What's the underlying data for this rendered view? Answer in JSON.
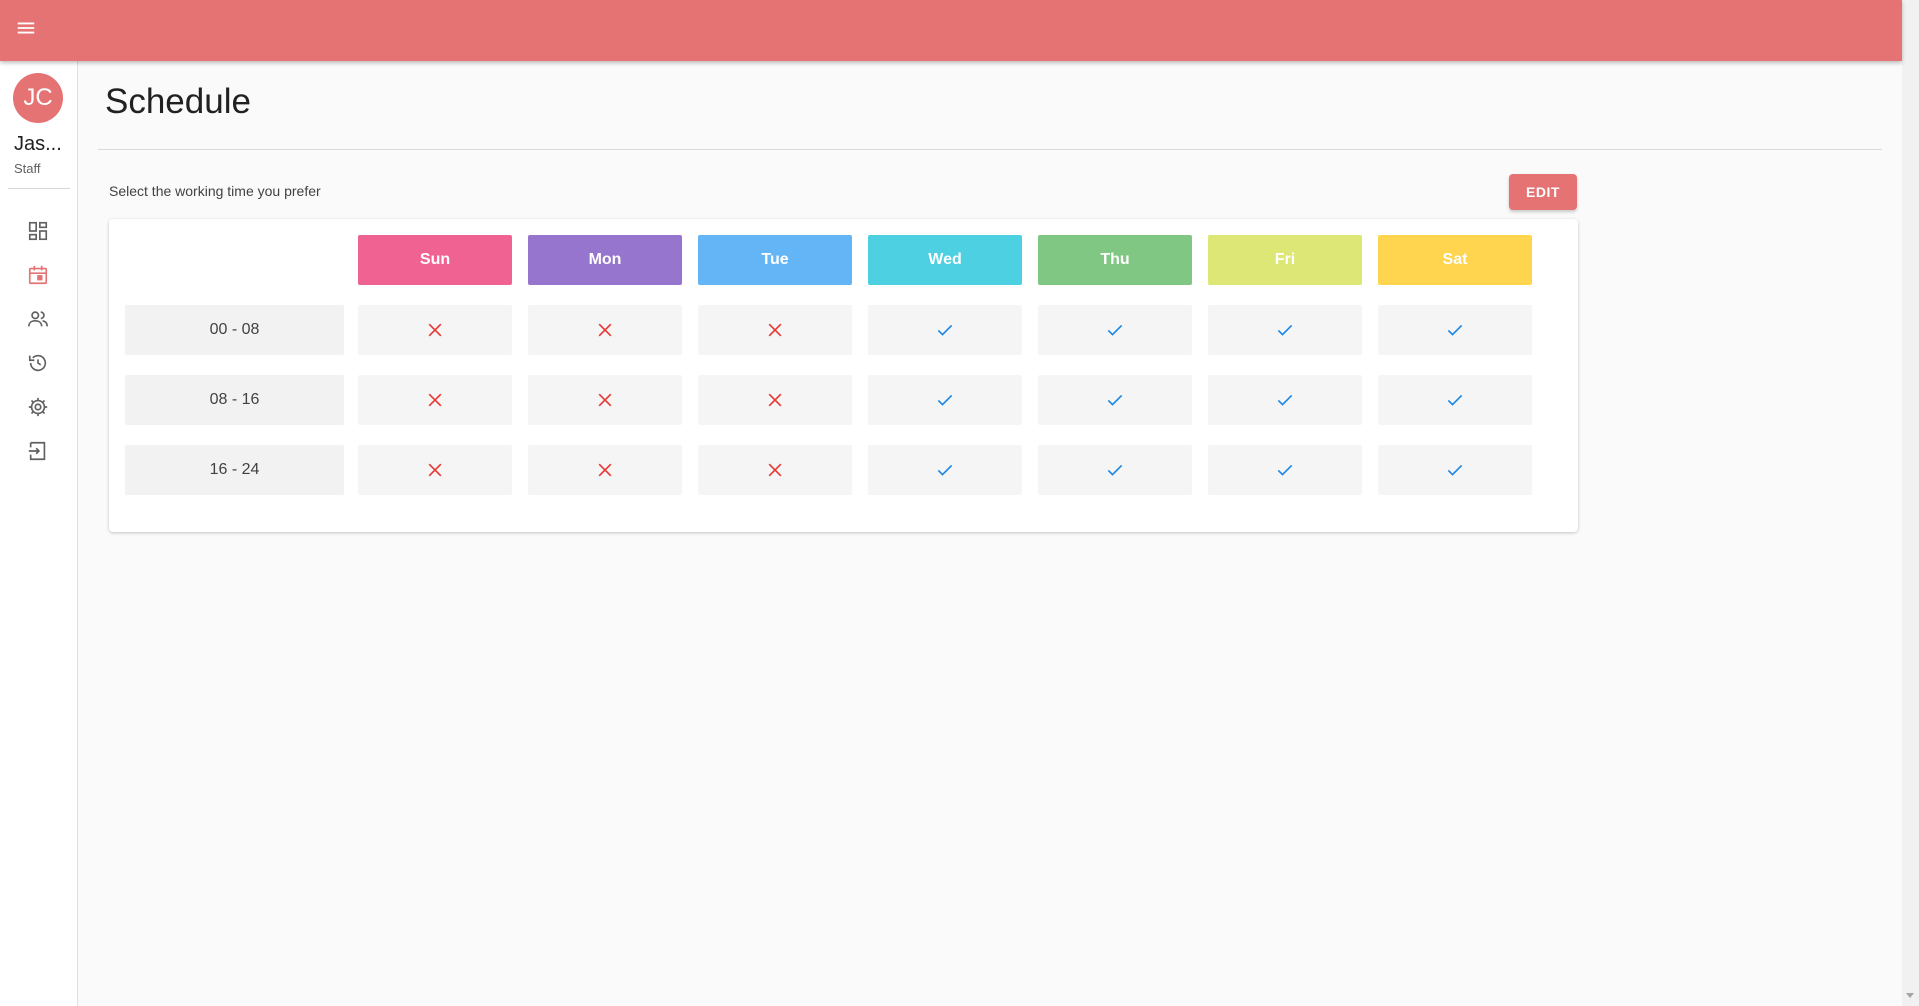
{
  "app": {
    "theme_color": "#e57373"
  },
  "user": {
    "initials": "JC",
    "name": "Jas...",
    "role": "Staff"
  },
  "nav": [
    {
      "icon": "dashboard-icon"
    },
    {
      "icon": "calendar-icon",
      "active": true
    },
    {
      "icon": "people-icon"
    },
    {
      "icon": "history-icon"
    },
    {
      "icon": "gear-icon"
    },
    {
      "icon": "logout-icon"
    }
  ],
  "page": {
    "title": "Schedule",
    "subtitle": "Select the working time you prefer",
    "edit_label": "EDIT"
  },
  "schedule": {
    "days": [
      {
        "label": "Sun",
        "color": "#f06292"
      },
      {
        "label": "Mon",
        "color": "#9575cd"
      },
      {
        "label": "Tue",
        "color": "#64b5f6"
      },
      {
        "label": "Wed",
        "color": "#4dd0e1"
      },
      {
        "label": "Thu",
        "color": "#81c784"
      },
      {
        "label": "Fri",
        "color": "#dce775"
      },
      {
        "label": "Sat",
        "color": "#ffd54f"
      }
    ],
    "rows": [
      {
        "time": "00 - 08",
        "values": [
          false,
          false,
          false,
          true,
          true,
          true,
          true
        ]
      },
      {
        "time": "08 - 16",
        "values": [
          false,
          false,
          false,
          true,
          true,
          true,
          true
        ]
      },
      {
        "time": "16 - 24",
        "values": [
          false,
          false,
          false,
          true,
          true,
          true,
          true
        ]
      }
    ],
    "check_color": "#1e88e5",
    "cross_color": "#e53935"
  }
}
